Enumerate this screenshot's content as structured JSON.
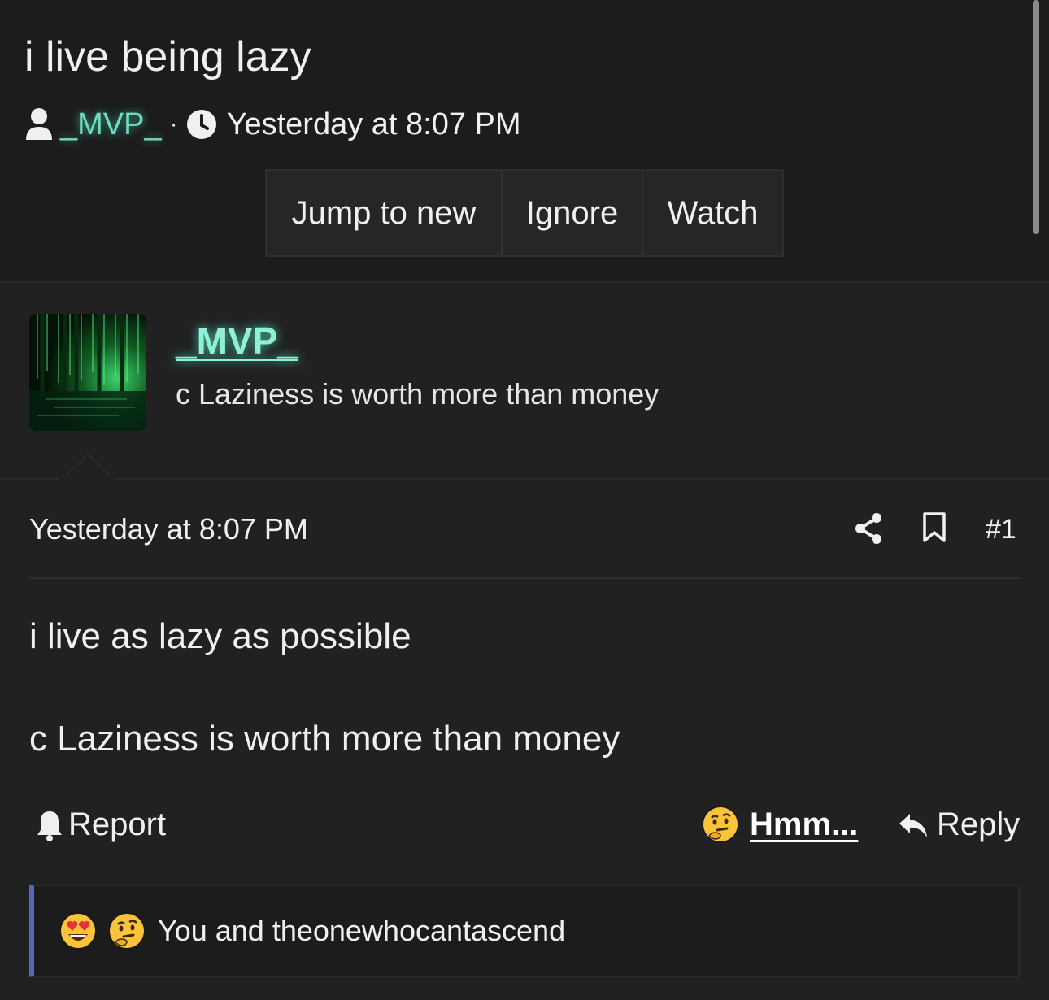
{
  "thread": {
    "title": "i live being lazy",
    "author": "_MVP_",
    "separator": "·",
    "date": "Yesterday at 8:07 PM"
  },
  "actions": {
    "jump_to_new": "Jump to new",
    "ignore": "Ignore",
    "watch": "Watch"
  },
  "author_box": {
    "name": "_MVP_",
    "user_title": "c Laziness is worth more than money"
  },
  "post": {
    "date": "Yesterday at 8:07 PM",
    "number": "#1",
    "body_line1": "i live as lazy as possible",
    "body_line2": "c Laziness is worth more than money",
    "report_label": "Report",
    "reaction_label": "Hmm...",
    "reply_label": "Reply"
  },
  "reactions_bar": {
    "text": "You and theonewhocantascend",
    "icons": [
      "heart-eyes-emoji",
      "thinking-emoji"
    ]
  },
  "colors": {
    "username": "#6fdcc0",
    "reaction_accent": "#5865b8",
    "background": "#1c1c1c",
    "panel": "#212121"
  }
}
